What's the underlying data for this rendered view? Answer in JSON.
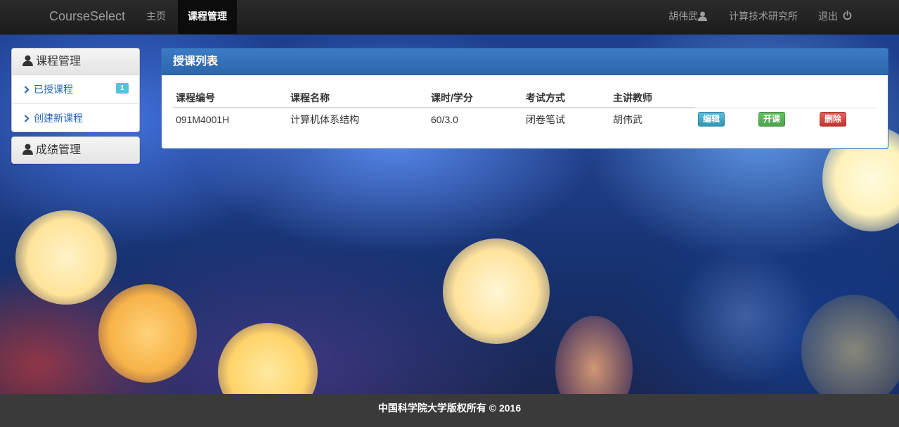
{
  "navbar": {
    "brand": "CourseSelect",
    "links": [
      "主页",
      "课程管理"
    ],
    "user_name": "胡伟武",
    "institute": "计算技术研究所",
    "logout": "退出"
  },
  "sidebar": {
    "course_panel": {
      "title": "课程管理",
      "items": [
        {
          "label": "已授课程",
          "badge": "1"
        },
        {
          "label": "创建新课程"
        }
      ]
    },
    "grade_panel": {
      "title": "成绩管理"
    }
  },
  "main": {
    "title": "授课列表",
    "columns": [
      "课程编号",
      "课程名称",
      "课时/学分",
      "考试方式",
      "主讲教师"
    ],
    "rows": [
      {
        "code": "091M4001H",
        "name": "计算机体系结构",
        "hours": "60/3.0",
        "exam": "闭卷笔试",
        "teacher": "胡伟武",
        "actions": [
          "编辑",
          "开课",
          "删除"
        ]
      }
    ]
  },
  "footer": {
    "text": "中国科学院大学版权所有 © 2016"
  },
  "colors": {
    "primary": "#2c65ab",
    "info": "#5bc0de",
    "success": "#51a351",
    "danger": "#bd362f"
  }
}
